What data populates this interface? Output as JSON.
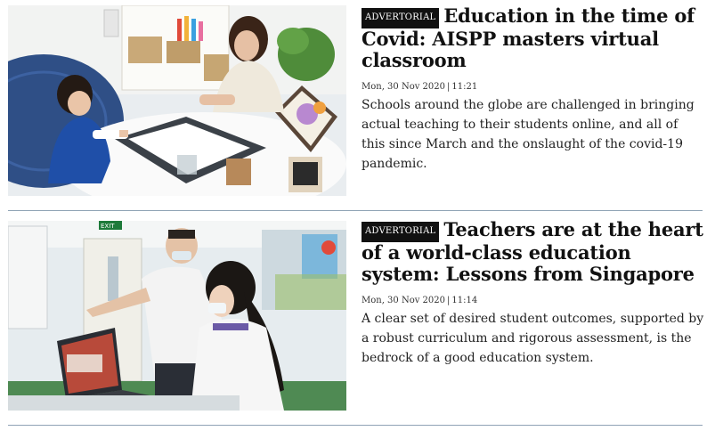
{
  "articles": [
    {
      "badge": "ADVERTORIAL",
      "headline": "Education in the time of Covid: AISPP masters virtual classroom",
      "date": "Mon, 30 Nov 2020",
      "time": "11:21",
      "excerpt": "Schools around the globe are challenged in bringing actual teaching to their students online, and all of this since March and the onslaught of the covid-19 pandemic.",
      "image": "classroom-children-painting-photo"
    },
    {
      "badge": "ADVERTORIAL",
      "headline": "Teachers are at the heart of a world-class education system: Lessons from Singapore",
      "date": "Mon, 30 Nov 2020",
      "time": "11:14",
      "excerpt": "A clear set of desired student outcomes, supported by a robust curriculum and rigorous assessment, is the bedrock of a good education system.",
      "image": "teacher-student-laptop-photo",
      "exit_sign": "EXIT"
    }
  ],
  "colors": {
    "divider": "#8fa3b5",
    "badge_bg": "#111111",
    "badge_text": "#ffffff"
  }
}
